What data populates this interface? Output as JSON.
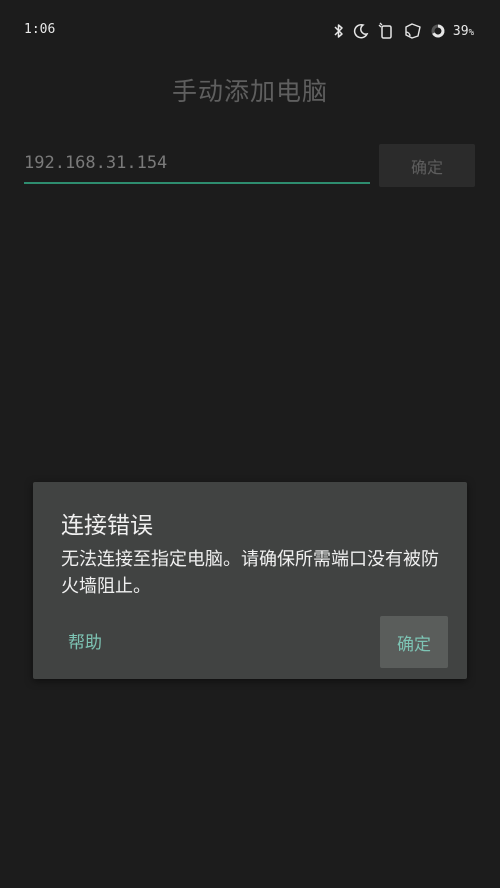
{
  "status_bar": {
    "time": "1:06",
    "battery_percent": "39",
    "battery_unit": "%",
    "icons": [
      "bluetooth-icon",
      "do-not-disturb-icon",
      "vibrate-icon",
      "cast-icon",
      "battery-ring-icon"
    ]
  },
  "page": {
    "title": "手动添加电脑",
    "ip_input": {
      "value": "192.168.31.154"
    },
    "confirm_label": "确定",
    "accent_color": "#2e8d6f"
  },
  "dialog": {
    "title": "连接错误",
    "message": "无法连接至指定电脑。请确保所需端口没有被防火墙阻止。",
    "help_label": "帮助",
    "ok_label": "确定",
    "action_color": "#7dc4b4"
  }
}
